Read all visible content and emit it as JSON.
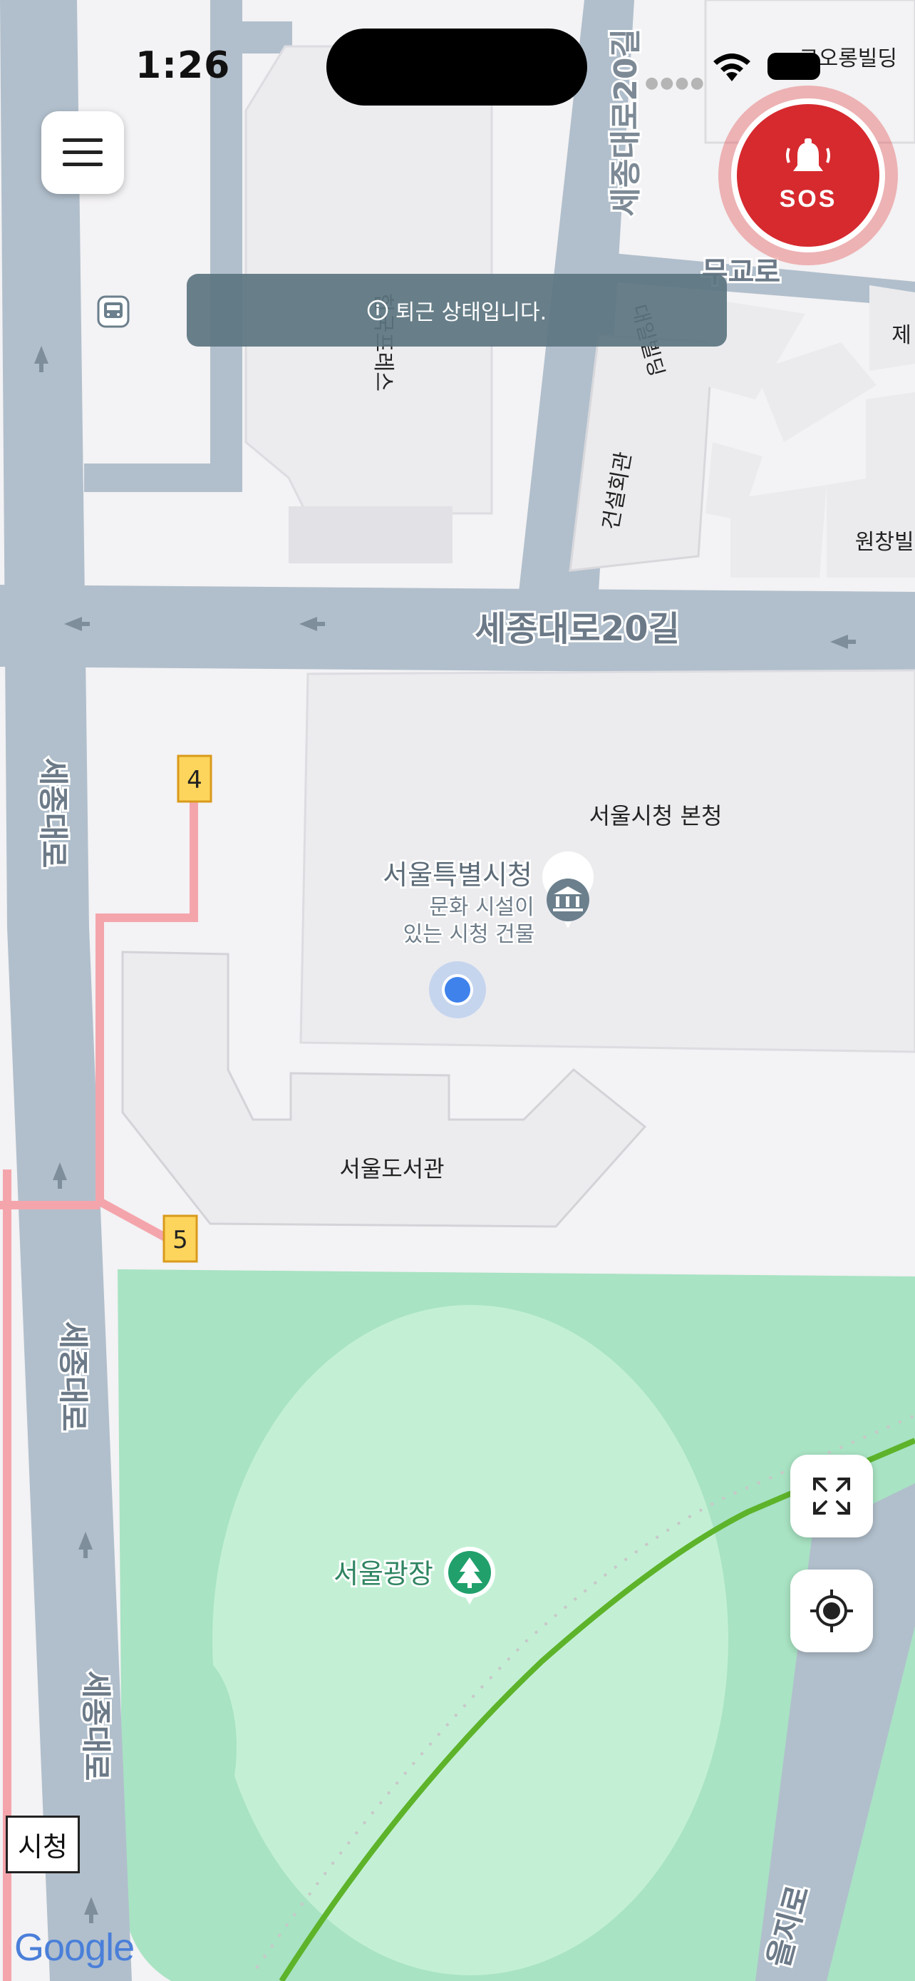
{
  "status_bar": {
    "time": "1:26"
  },
  "top_controls": {
    "sos_label": "SOS"
  },
  "toast": {
    "message": "퇴근 상태입니다."
  },
  "map": {
    "roads": {
      "sejong_daero_20gil_top": "세종대로20길",
      "sejong_daero_20gil": "세종대로20길",
      "sejong_daero_1": "세종대로",
      "sejong_daero_2": "세종대로",
      "sejong_daero_3": "세종대로",
      "mugyo_ro": "무교로",
      "euljiro": "을지로"
    },
    "buildings": {
      "korea_press": "한국프레스",
      "daeil": "대일빌딩",
      "construction_hall": "건설회관",
      "wonchang": "원창빌딩",
      "je": "제",
      "kolon": "코오롱빌딩",
      "city_hall_main": "서울시청 본청",
      "library": "서울도서관"
    },
    "pois": {
      "city_hall": {
        "name": "서울특별시청",
        "desc_line1": "문화 시설이",
        "desc_line2": "있는 시청 건물"
      },
      "plaza": {
        "name": "서울광장"
      }
    },
    "exits": {
      "exit4": "4",
      "exit5": "5"
    },
    "station_label": "시청",
    "attribution": "Google"
  },
  "colors": {
    "sos": "#d62a2f",
    "toast": "#5c7580",
    "location_dot": "#3f82ec",
    "park": "#a8e3c3",
    "park_inner": "#c3f0d5",
    "subway_line": "#5db329",
    "road": "#b1bfcc",
    "walk_route": "#f4a5ac",
    "exit_badge": "#fdd55c"
  }
}
